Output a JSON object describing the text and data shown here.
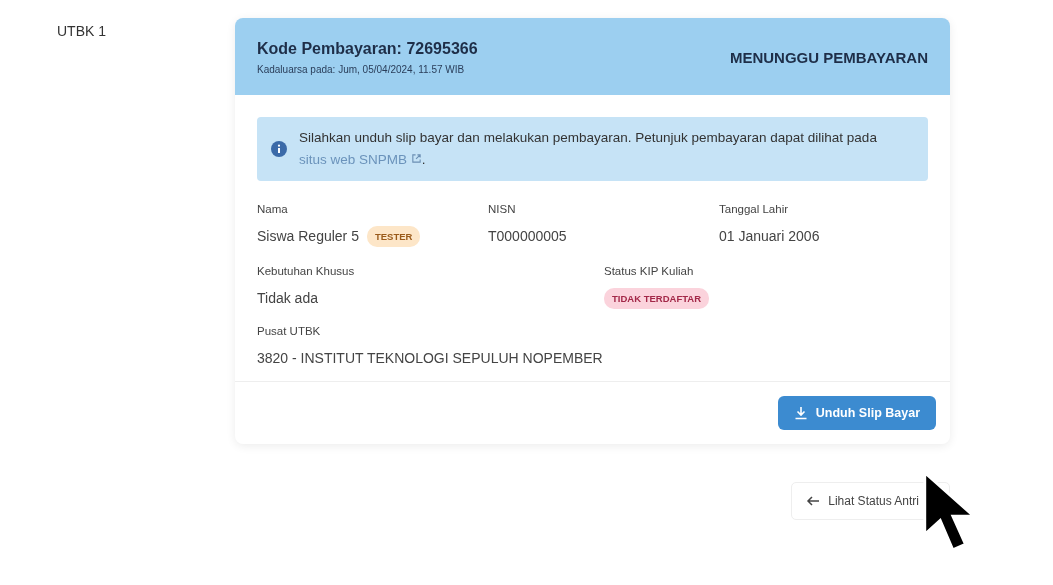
{
  "section_label": "UTBK 1",
  "payment": {
    "code": "Kode Pembayaran: 72695366",
    "expiry": "Kadaluarsa pada: Jum, 05/04/2024, 11.57 WIB",
    "status": "MENUNGGU PEMBAYARAN"
  },
  "notice": {
    "text_before": "Silahkan unduh slip bayar dan melakukan pembayaran. Petunjuk pembayaran dapat dilihat pada",
    "link": "situs web SNPMB",
    "text_after": "."
  },
  "fields": [
    {
      "label": "Nama",
      "value": "Siswa Reguler 5",
      "badge": {
        "text": "TESTER",
        "kind": "warning"
      }
    },
    {
      "label": "NISN",
      "value": "T000000005"
    },
    {
      "label": "Tanggal Lahir",
      "value": "01 Januari 2006"
    },
    {
      "label": "Kebutuhan Khusus",
      "value": "Tidak ada"
    },
    {
      "label": "Status KIP Kuliah",
      "badge": {
        "text": "TIDAK TERDAFTAR",
        "kind": "danger"
      }
    },
    {
      "label": "Pusat UTBK",
      "value": "3820 - INSTITUT TEKNOLOGI SEPULUH NOPEMBER"
    }
  ],
  "download_button": "Unduh Slip Bayar",
  "queue_button": "Lihat Status Antri"
}
